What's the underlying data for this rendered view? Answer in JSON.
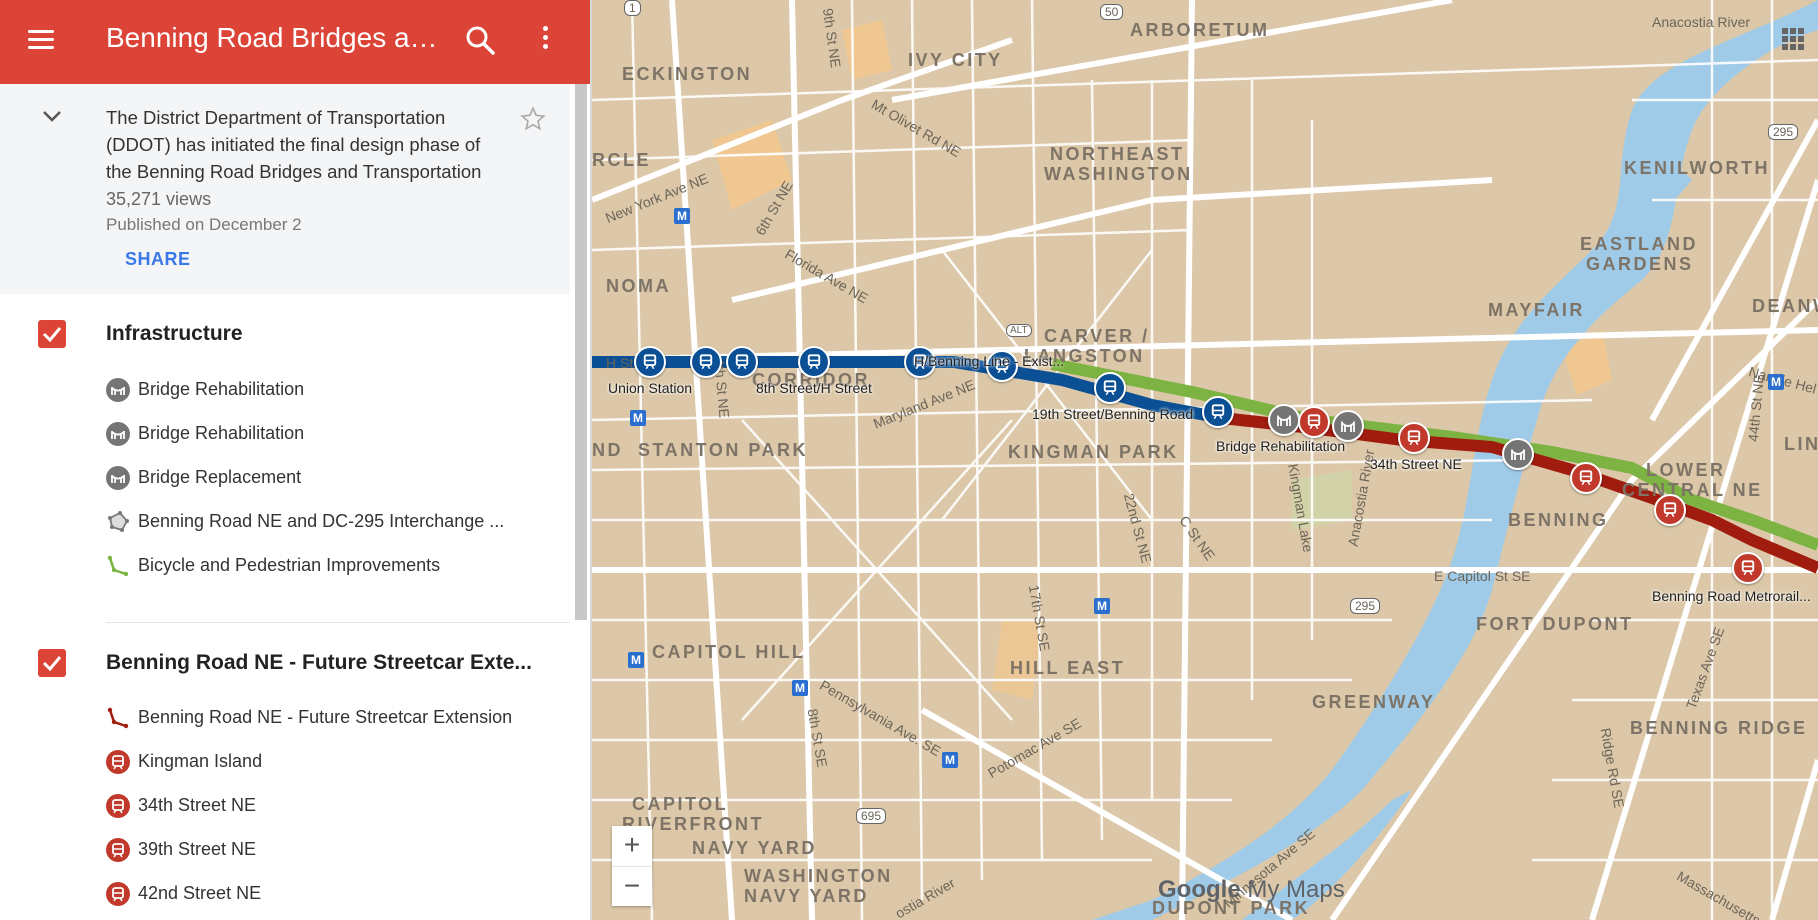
{
  "header": {
    "title": "Benning Road Bridges an...",
    "menu_icon": "menu-icon",
    "search_icon": "search-icon",
    "more_icon": "more-vert-icon",
    "color": "#db4437"
  },
  "info": {
    "description": "The District Department of Transportation (DDOT) has initiated the final design phase of the Benning Road Bridges and Transportation",
    "views": "35,271 views",
    "published": "Published on December 2",
    "share_label": "SHARE"
  },
  "layers": [
    {
      "title": "Infrastructure",
      "checked": true,
      "items": [
        {
          "label": "Bridge Rehabilitation",
          "icon": "bridge-icon"
        },
        {
          "label": "Bridge Rehabilitation",
          "icon": "bridge-icon"
        },
        {
          "label": "Bridge Replacement",
          "icon": "bridge-icon"
        },
        {
          "label": "Benning Road NE and DC-295 Interchange ...",
          "icon": "polygon-icon"
        },
        {
          "label": "Bicycle and Pedestrian Improvements",
          "icon": "line-icon"
        }
      ]
    },
    {
      "title": "Benning Road NE - Future Streetcar Exte...",
      "checked": true,
      "items": [
        {
          "label": "Benning Road NE - Future Streetcar Extension",
          "icon": "line-icon"
        },
        {
          "label": "Kingman Island",
          "icon": "tram-icon"
        },
        {
          "label": "34th Street NE",
          "icon": "tram-icon"
        },
        {
          "label": "39th Street NE",
          "icon": "tram-icon"
        },
        {
          "label": "42nd Street NE",
          "icon": "tram-icon"
        }
      ]
    }
  ],
  "map": {
    "neighborhoods": [
      "ECKINGTON",
      "IVY CITY",
      "ARBORETUM",
      "NORTHEAST",
      "WASHINGTON",
      "NOMA",
      "CORRIDOR",
      "CARVER /",
      "LANGSTON",
      "STANTON PARK",
      "KINGMAN PARK",
      "KENILWORTH",
      "EASTLAND",
      "GARDENS",
      "MAYFAIR",
      "DEANW",
      "LOWER",
      "CENTRAL NE",
      "BENNING",
      "LIN",
      "CAPITOL HILL",
      "HILL EAST",
      "FORT DUPONT",
      "GREENWAY",
      "BENNING RIDGE",
      "CAPITOL",
      "RIVERFRONT",
      "NAVY YARD",
      "WASHINGTON",
      "NAVY YARD",
      "DUPONT PARK",
      "RCLE",
      "ND"
    ],
    "streets": [
      "New York Ave NE",
      "9th St NE",
      "Mt Olivet Rd NE",
      "6th St NE",
      "Florida Ave NE",
      "Maryland Ave NE",
      "Kingman Lake",
      "Anacostia River",
      "Anacostia River",
      "22nd St NE",
      "C St NE",
      "17th St SE",
      "E Capitol St SE",
      "Pennsylvania Ave. SE",
      "Potomac Ave SE",
      "8th St SE",
      "Ridge Rd SE",
      "Texas Ave SE",
      "44th St NE",
      "Nannie Hel",
      "Massachusetts",
      "4th St NE",
      "H St",
      "ostia River",
      "Minnesota Ave SE"
    ],
    "highway_shields": [
      "50",
      "295",
      "295",
      "695",
      "1",
      "ALT"
    ],
    "station_labels": [
      "Union Station",
      "8th Street/H Street",
      "H/Benning Line - Exist...",
      "19th Street/Benning Road",
      "Bridge Rehabilitation",
      "34th Street NE",
      "Benning Road Metrorail..."
    ],
    "line_colors": {
      "existing": "#0b4f95",
      "future": "#a01c0f",
      "bike": "#7cb342",
      "tram_pin": "#c0392b",
      "existing_pin": "#0b4f95",
      "bridge_pin": "#757575"
    },
    "zoom_in": "+",
    "zoom_out": "−",
    "branding": {
      "google": "Google",
      "mymaps": "My Maps"
    }
  }
}
